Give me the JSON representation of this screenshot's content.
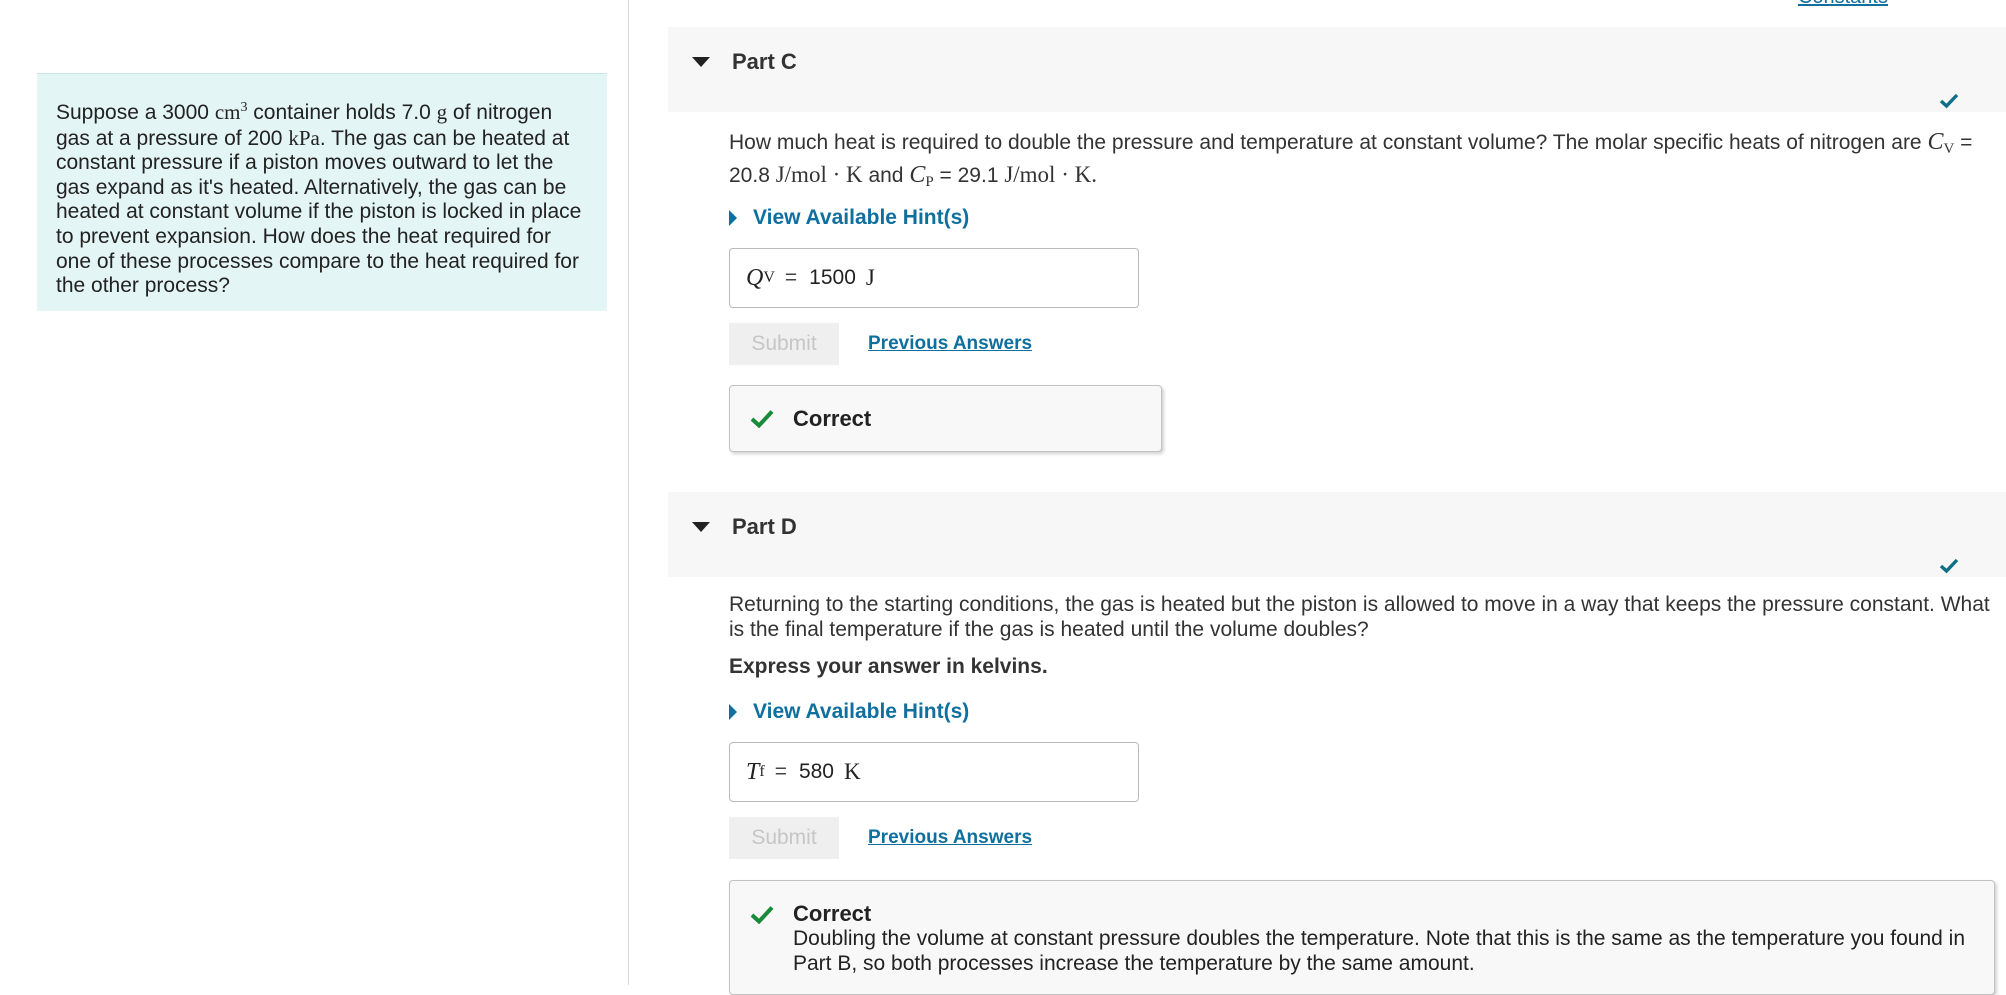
{
  "problem": {
    "t1": "Suppose a 3000 ",
    "u1": "cm",
    "u1sup": "3",
    "t2": " container holds 7.0 ",
    "u2": "g",
    "t3": " of nitrogen gas at a pressure of 200 ",
    "u3": "kPa",
    "t4": ". The gas can be heated at constant pressure if a piston moves outward to let the gas expand as it's heated. Alternatively, the gas can be heated at constant volume if the piston is locked in place to prevent expansion. How does the heat required for one of these processes compare to the heat required for the other process?"
  },
  "constants_link": "Constants",
  "partC": {
    "title": "Part C",
    "q1": "How much heat is required to double the pressure and temperature at constant volume? The molar specific heats of nitrogen are ",
    "cv": "C",
    "cv_sub": "V",
    "q2": " = ",
    "q3": "20.8 ",
    "u_a": "J/mol · K",
    "q4": " and ",
    "cp": "C",
    "cp_sub": "P",
    "q5": " = 29.1 ",
    "u_b": "J/mol · K.",
    "hint": "View Available Hint(s)",
    "answer_symbol": "Q",
    "answer_sub": "V",
    "answer_eq": "=",
    "answer_value": "1500",
    "answer_unit": "J",
    "submit": "Submit",
    "previous": "Previous Answers",
    "feedback_title": "Correct"
  },
  "partD": {
    "title": "Part D",
    "question": "Returning to the starting conditions, the gas is heated but the piston is allowed to move in a way that keeps the pressure constant. What is the final temperature if the gas is heated until the volume doubles?",
    "express": "Express your answer in kelvins.",
    "hint": "View Available Hint(s)",
    "answer_symbol": "T",
    "answer_sub": "f",
    "answer_eq": "=",
    "answer_value": "580",
    "answer_unit": "K",
    "submit": "Submit",
    "previous": "Previous Answers",
    "feedback_title": "Correct",
    "feedback_text": "Doubling the volume at constant pressure doubles the temperature. Note that this is the same as the temperature you found in Part B, so both processes increase the temperature by the same amount."
  },
  "colors": {
    "link": "#0f6f9e",
    "check_teal": "#0f6f86",
    "check_green": "#1a8a3a",
    "problem_bg": "#e4f5f5"
  }
}
